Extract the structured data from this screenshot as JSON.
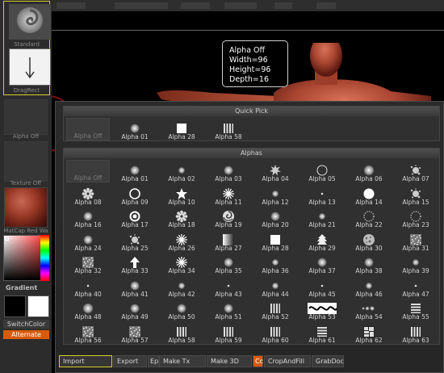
{
  "shelf": {
    "brush_label": "Standard",
    "stroke_label": "DragRect",
    "alpha_label": "Alpha Off",
    "texture_label": "Texture Off",
    "material_label": "MatCap Red Wa",
    "gradient_label": "Gradient",
    "switchcolor_label": "SwitchColor",
    "alternate_label": "Alternate",
    "colors": {
      "main": "#000000",
      "secondary": "#ffffff",
      "accent": "#d85a0c",
      "highlight": "#d6cd2c"
    }
  },
  "tooltip": {
    "line1": "Alpha Off",
    "line2": "Width=96",
    "line3": "Height=96",
    "line4": "Depth=16"
  },
  "popup": {
    "quick_pick_title": "Quick Pick",
    "quick_pick": [
      {
        "label": "Alpha Off",
        "icon": "none"
      },
      {
        "label": "Alpha 01",
        "icon": "soft-dot"
      },
      {
        "label": "Alpha 28",
        "icon": "square"
      },
      {
        "label": "Alpha 58",
        "icon": "vertical-stripes"
      }
    ],
    "alphas_title": "Alphas",
    "alphas": [
      {
        "label": "Alpha Off",
        "icon": "none"
      },
      {
        "label": "Alpha 01",
        "icon": "soft-dot"
      },
      {
        "label": "Alpha 02",
        "icon": "soft-dot-small"
      },
      {
        "label": "Alpha 03",
        "icon": "soft-dot"
      },
      {
        "label": "Alpha 04",
        "icon": "spiky-blob"
      },
      {
        "label": "Alpha 05",
        "icon": "ring-thin"
      },
      {
        "label": "Alpha 06",
        "icon": "soft-dot-large"
      },
      {
        "label": "Alpha 07",
        "icon": "splatter"
      },
      {
        "label": "Alpha 08",
        "icon": "gear"
      },
      {
        "label": "Alpha 09",
        "icon": "ring"
      },
      {
        "label": "Alpha 10",
        "icon": "star"
      },
      {
        "label": "Alpha 11",
        "icon": "starburst"
      },
      {
        "label": "Alpha 12",
        "icon": "soft-dot-small"
      },
      {
        "label": "Alpha 13",
        "icon": "tiny-dot"
      },
      {
        "label": "Alpha 14",
        "icon": "disc"
      },
      {
        "label": "Alpha 15",
        "icon": "splatter"
      },
      {
        "label": "Alpha 16",
        "icon": "soft-dot"
      },
      {
        "label": "Alpha 17",
        "icon": "target"
      },
      {
        "label": "Alpha 18",
        "icon": "gear"
      },
      {
        "label": "Alpha 19",
        "icon": "swirl"
      },
      {
        "label": "Alpha 20",
        "icon": "soft-dot"
      },
      {
        "label": "Alpha 21",
        "icon": "soft-dot-small"
      },
      {
        "label": "Alpha 22",
        "icon": "dotted-ring"
      },
      {
        "label": "Alpha 23",
        "icon": "dotted-ring"
      },
      {
        "label": "Alpha 24",
        "icon": "soft-dot"
      },
      {
        "label": "Alpha 25",
        "icon": "splatter"
      },
      {
        "label": "Alpha 26",
        "icon": "starburst"
      },
      {
        "label": "Alpha 27",
        "icon": "gradient-square"
      },
      {
        "label": "Alpha 28",
        "icon": "square"
      },
      {
        "label": "Alpha 29",
        "icon": "tree"
      },
      {
        "label": "Alpha 30",
        "icon": "texture-disc"
      },
      {
        "label": "Alpha 31",
        "icon": "noise-square"
      },
      {
        "label": "Alpha 32",
        "icon": "noise-square"
      },
      {
        "label": "Alpha 33",
        "icon": "arrow-up"
      },
      {
        "label": "Alpha 34",
        "icon": "starburst"
      },
      {
        "label": "Alpha 35",
        "icon": "soft-dot"
      },
      {
        "label": "Alpha 36",
        "icon": "soft-dot-small"
      },
      {
        "label": "Alpha 37",
        "icon": "soft-dot"
      },
      {
        "label": "Alpha 38",
        "icon": "soft-dot"
      },
      {
        "label": "Alpha 39",
        "icon": "soft-dot-small"
      },
      {
        "label": "Alpha 40",
        "icon": "tiny-dot"
      },
      {
        "label": "Alpha 41",
        "icon": "soft-dot"
      },
      {
        "label": "Alpha 42",
        "icon": "soft-dot-small"
      },
      {
        "label": "Alpha 43",
        "icon": "tiny-dot"
      },
      {
        "label": "Alpha 44",
        "icon": "soft-dot-small"
      },
      {
        "label": "Alpha 45",
        "icon": "tiny-dot"
      },
      {
        "label": "Alpha 46",
        "icon": "soft-dot-small"
      },
      {
        "label": "Alpha 47",
        "icon": "tiny-dot"
      },
      {
        "label": "Alpha 48",
        "icon": "soft-dot-large"
      },
      {
        "label": "Alpha 49",
        "icon": "soft-dot"
      },
      {
        "label": "Alpha 50",
        "icon": "soft-dot"
      },
      {
        "label": "Alpha 51",
        "icon": "soft-dot"
      },
      {
        "label": "Alpha 52",
        "icon": "vertical-stripes"
      },
      {
        "label": "Alpha 53",
        "icon": "pattern-wide"
      },
      {
        "label": "Alpha 54",
        "icon": "dot-row"
      },
      {
        "label": "Alpha 55",
        "icon": "horizontal-stripes"
      },
      {
        "label": "Alpha 56",
        "icon": "noise-square"
      },
      {
        "label": "Alpha 57",
        "icon": "noise-square"
      },
      {
        "label": "Alpha 58",
        "icon": "vertical-stripes"
      },
      {
        "label": "Alpha 59",
        "icon": "vertical-stripes"
      },
      {
        "label": "Alpha 60",
        "icon": "vertical-stripes"
      },
      {
        "label": "Alpha 61",
        "icon": "horizontal-stripes"
      },
      {
        "label": "Alpha 62",
        "icon": "stone-tiles"
      },
      {
        "label": "Alpha 63",
        "icon": "vertical-stripes"
      }
    ],
    "buttons": {
      "import": "Import",
      "export": "Export",
      "ep": "Ep",
      "make_tx": "Make Tx",
      "make_3d": "Make 3D",
      "cc": "Cc",
      "crop_and_fill": "CropAndFill",
      "grab_doc": "GrabDoc"
    }
  }
}
